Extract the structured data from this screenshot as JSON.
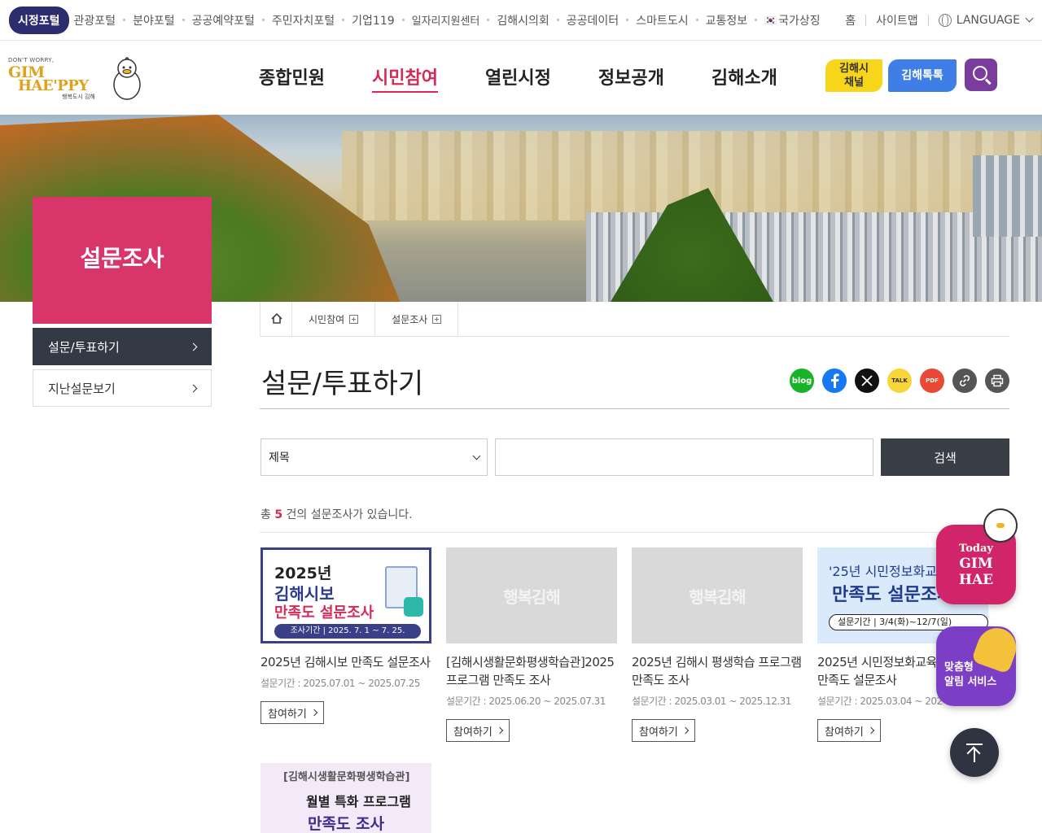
{
  "topbar": {
    "active_portal": "시정포털",
    "portals": [
      "관광포털",
      "분야포털",
      "공공예약포털",
      "주민자치포털",
      "기업119",
      "일자리지원센터",
      "김해시의회",
      "공공데이터",
      "스마트도시",
      "교통정보",
      "국가상징"
    ],
    "home": "홈",
    "sitemap": "사이트맵",
    "language": "LANGUAGE"
  },
  "logo": {
    "small": "DON'T WORRY,",
    "line1": "GIM",
    "line2": "HAE'PPY",
    "tagline": "행복도시 김해"
  },
  "gnb": [
    {
      "label": "종합민원",
      "active": false
    },
    {
      "label": "시민참여",
      "active": true
    },
    {
      "label": "열린시정",
      "active": false
    },
    {
      "label": "정보공개",
      "active": false
    },
    {
      "label": "김해소개",
      "active": false
    }
  ],
  "header_buttons": {
    "channel_line1": "김해시",
    "channel_line2": "채널",
    "talk": "김해톡톡"
  },
  "side": {
    "title": "설문조사",
    "menu": [
      {
        "label": "설문/투표하기",
        "active": true
      },
      {
        "label": "지난설문보기",
        "active": false
      }
    ]
  },
  "breadcrumb": {
    "items": [
      "시민참여",
      "설문조사"
    ]
  },
  "page": {
    "title": "설문/투표하기"
  },
  "share": {
    "blog": "blog",
    "kakao": "TALK",
    "pdf": "PDF",
    "colors": {
      "blog": "#19b32a",
      "facebook": "#1877f2",
      "x": "#111111",
      "kakao": "#f8d63a",
      "pdf": "#e94a35",
      "link": "#555555",
      "print": "#555555"
    }
  },
  "search": {
    "field_selected": "제목",
    "query": "",
    "button": "검색"
  },
  "result": {
    "prefix": "총",
    "count": "5",
    "suffix": "건의 설문조사가 있습니다."
  },
  "surveys": [
    {
      "title": "2025년 김해시보 만족도 설문조사",
      "period": "설문기간 : 2025.07.01 ~ 2025.07.25",
      "button": "참여하기",
      "thumb": {
        "line1": "2025년",
        "line2": "김해시보",
        "line3": "만족도 설문조사",
        "period": "조사기간 | 2025. 7. 1 ~ 7. 25."
      }
    },
    {
      "title": "[김해시생활문화평생학습관]2025 프로그램 만족도 조사",
      "period": "설문기간 : 2025.06.20 ~ 2025.07.31",
      "button": "참여하기",
      "thumb": {
        "watermark": "행복김해"
      }
    },
    {
      "title": "2025년 김해시 평생학습 프로그램 만족도 조사",
      "period": "설문기간 : 2025.03.01 ~ 2025.12.31",
      "button": "참여하기",
      "thumb": {
        "watermark": "행복김해"
      }
    },
    {
      "title": "2025년 시민정보화교육 만족도 설문조사",
      "period": "설문기간 : 2025.03.04 ~ 2025.12.31",
      "button": "참여하기",
      "thumb": {
        "line1": "'25년 시민정보화교육",
        "line2": "만족도 설문조사",
        "period": "설문기간 | 3/4(화)~12/7(일)"
      }
    },
    {
      "thumb": {
        "line1": "[김해시생활문화평생학습관]",
        "line2": "월별 특화 프로그램",
        "line3": "만족도 조사"
      }
    }
  ],
  "floating": {
    "today_line1": "Today",
    "today_line2": "GIM",
    "today_line3": "HAE",
    "alarm_line1": "맞춤형",
    "alarm_line2": "알림 서비스"
  }
}
